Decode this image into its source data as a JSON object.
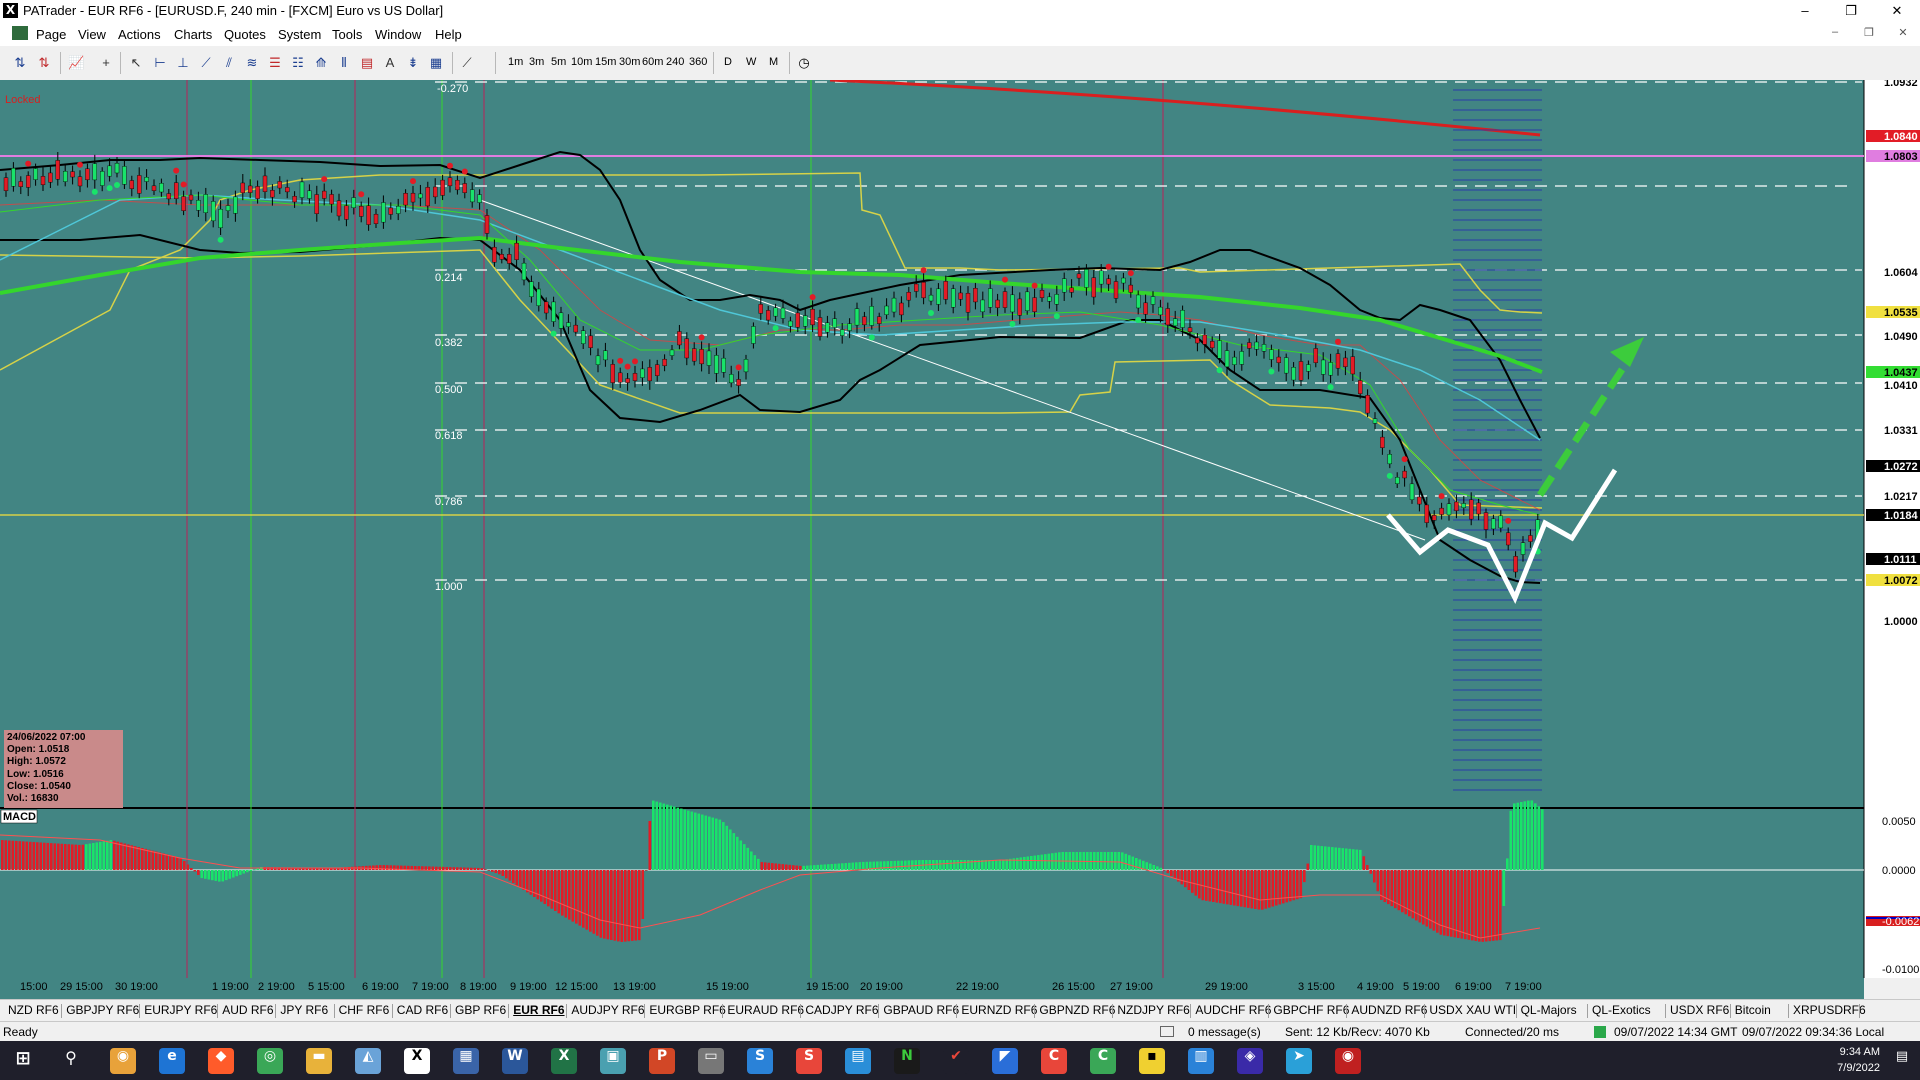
{
  "window": {
    "title": "PATrader - EUR RF6 - [EURUSD.F, 240 min - [FXCM] Euro vs US Dollar]",
    "app_icon": "X",
    "minimize": "–",
    "maximize": "❐",
    "close": "✕"
  },
  "menu": {
    "items": [
      "Page",
      "View",
      "Actions",
      "Charts",
      "Quotes",
      "System",
      "Tools",
      "Window",
      "Help"
    ],
    "mdi_controls": [
      "–",
      "❐",
      "✕"
    ]
  },
  "toolbar": {
    "timeframes": [
      "1m",
      "3m",
      "5m",
      "10m",
      "15m",
      "30m",
      "60m",
      "240",
      "360"
    ],
    "periods": [
      "D",
      "W",
      "M"
    ]
  },
  "chart": {
    "locked_label": "Locked",
    "colors": {
      "background": "#428583",
      "bullish": "#19e36a",
      "bearish": "#e21c26",
      "ma_long": "#34d62c",
      "ma_200": "#d81f1f",
      "bands": "#000000",
      "channel": "#d6d248",
      "forecast": "#ffffff",
      "arrow": "#3ccc3c"
    },
    "fib_levels": [
      "-0.270",
      "0.214",
      "0.382",
      "0.500",
      "0.618",
      "0.786",
      "1.000"
    ],
    "price_labels": [
      {
        "text": "1.0932",
        "color": "#ffffff",
        "text_color": "#000000"
      },
      {
        "text": "1.0840",
        "color": "#e21c26",
        "text_color": "#ffffff"
      },
      {
        "text": "1.0803",
        "color": "#e07de0",
        "text_color": "#000000"
      },
      {
        "text": "1.0604",
        "color": "#ffffff",
        "text_color": "#000000"
      },
      {
        "text": "1.0535",
        "color": "#f0e040",
        "text_color": "#000000"
      },
      {
        "text": "1.0490",
        "color": "#ffffff",
        "text_color": "#000000"
      },
      {
        "text": "1.0437",
        "color": "#33dd33",
        "text_color": "#000000"
      },
      {
        "text": "1.0410",
        "color": "#ffffff",
        "text_color": "#000000"
      },
      {
        "text": "1.0331",
        "color": "#ffffff",
        "text_color": "#000000"
      },
      {
        "text": "1.0272",
        "color": "#000000",
        "text_color": "#ffffff"
      },
      {
        "text": "1.0217",
        "color": "#ffffff",
        "text_color": "#000000"
      },
      {
        "text": "1.0184",
        "color": "#000000",
        "text_color": "#ffffff"
      },
      {
        "text": "1.0111",
        "color": "#000000",
        "text_color": "#ffffff"
      },
      {
        "text": "1.0072",
        "color": "#f0e040",
        "text_color": "#000000"
      },
      {
        "text": "1.0000",
        "color": "#ffffff",
        "text_color": "#000000"
      }
    ],
    "time_labels": [
      "15:00",
      "29 15:00",
      "30 19:00",
      "1 19:00",
      "2 19:00",
      "5 15:00",
      "6 19:00",
      "7 19:00",
      "8 19:00",
      "9 19:00",
      "12 15:00",
      "13 19:00",
      "15 19:00",
      "19 15:00",
      "20 19:00",
      "22 19:00",
      "26 15:00",
      "27 19:00",
      "29 19:00",
      "3 15:00",
      "4 19:00",
      "5 19:00",
      "6 19:00",
      "7 19:00"
    ]
  },
  "infobox": {
    "date": "24/06/2022 07:00",
    "open": "Open: 1.0518",
    "high": "High: 1.0572",
    "low": "Low: 1.0516",
    "close": "Close: 1.0540",
    "vol": "Vol.: 16830"
  },
  "macd": {
    "label": "MACD",
    "scale": [
      "0.0050",
      "0.0000",
      "-0.0062",
      "-0.0100"
    ]
  },
  "symbol_tabs": [
    "NZD RF6",
    "GBPJPY RF6",
    "EURJPY RF6",
    "AUD RF6",
    "JPY RF6",
    "CHF RF6",
    "CAD RF6",
    "GBP RF6",
    "EUR RF6",
    "AUDJPY RF6",
    "EURGBP RF6",
    "EURAUD RF6",
    "CADJPY RF6",
    "GBPAUD RF6",
    "EURNZD RF6",
    "GBPNZD RF6",
    "NZDJPY RF6",
    "AUDCHF RF6",
    "GBPCHF RF6",
    "AUDNZD RF6",
    "USDX XAU WTI",
    "QL-Majors",
    "QL-Exotics",
    "USDX RF6",
    "Bitcoin",
    "XRPUSDRF6"
  ],
  "active_tab": "EUR RF6",
  "status": {
    "ready": "Ready",
    "messages": "0 message(s)",
    "traffic": "Sent: 12 Kb/Recv: 4070 Kb",
    "connection": "Connected/20 ms",
    "gmt": "09/07/2022 14:34 GMT",
    "local": "09/07/2022 09:34:36 Local"
  },
  "taskbar": {
    "time": "9:34 AM",
    "date": "7/9/2022"
  }
}
